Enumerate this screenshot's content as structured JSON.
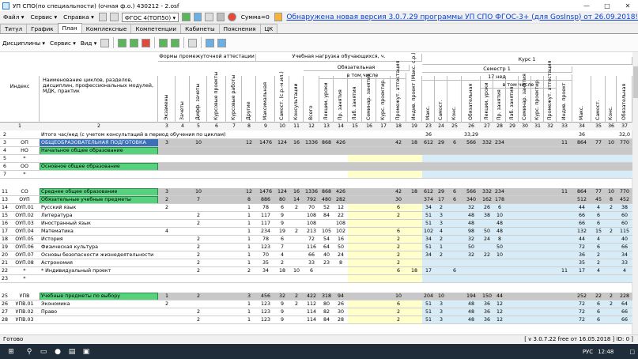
{
  "title": "УП СПО(по специальности) (очная ф.о.) 430212 - 2.osf",
  "menu": {
    "file": "Файл",
    "service": "Сервис",
    "help": "Справка",
    "fgos": "ФГОС 4(ТОП50)",
    "sum": "Сумма=0",
    "update": "Обнаружена новая версия 3.0.7.29 программы УП СПО ФГОС-3+ (для GosInsp) от 26.09.2018!"
  },
  "tabs": [
    "Титул",
    "График",
    "План",
    "Комплексные",
    "Компетенции",
    "Кабинеты",
    "Пояснения",
    "ЦК"
  ],
  "toolbar": {
    "disciplines": "Дисциплины",
    "service": "Сервис",
    "view": "Вид"
  },
  "header": {
    "index": "Индекс",
    "name": "Наименование циклов, разделов, дисциплин, профессиональных модулей, МДК, практик",
    "forms": "Формы промежуточной аттестации",
    "load": "Учебная нагрузка обучающихся, ч.",
    "obligatory": "Обязательная",
    "incl": "в том числе",
    "course1": "Курс 1",
    "sem1": "Семестр 1",
    "weeks": "17 нед",
    "incl2": "в том числе",
    "vert": {
      "c3": "Экзамены",
      "c4": "Зачеты",
      "c5": "Дифф. зачеты",
      "c6": "Курсовые проекты",
      "c7": "Курсовые работы",
      "c8": "Другие",
      "c9": "Максимальная",
      "c10": "Самост. (с.р.-н.ил.)",
      "c11": "Консультации",
      "c12": "Всего",
      "c13": "Лекции, уроки",
      "c14": "Пр. занятия",
      "c15": "Лаб. занятия",
      "c16": "Семинар. занятия",
      "c17": "Курс. проектир.",
      "c18": "Промежут. аттестация",
      "c19": "Индив. проект (Макс. с.р.)",
      "c23": "Макс.",
      "c24": "Самост.",
      "c25": "Конс.",
      "c26": "Обязательная",
      "c27": "Лекции, уроки",
      "c28": "Пр. занятия",
      "c29": "Лаб. занятия",
      "c30": "Семинар. занятия",
      "c31": "Курс. проектир.",
      "c32": "Промежут. аттестация",
      "c33": "Индив. проект",
      "c34": "Макс.",
      "c35": "Самост.",
      "c36": "Конс.",
      "c37": "Обязательная"
    }
  },
  "colnums": [
    "1",
    "2",
    "3",
    "4",
    "5",
    "6",
    "7",
    "8",
    "9",
    "10",
    "11",
    "12",
    "13",
    "14",
    "15",
    "16",
    "17",
    "18",
    "19",
    "20",
    "21",
    "22",
    "23",
    "24",
    "25",
    "26",
    "27",
    "28",
    "29",
    "30",
    "31",
    "32",
    "33",
    "34",
    "35",
    "36",
    "37"
  ],
  "rows": [
    {
      "n": "2",
      "idx": "",
      "name": "Итого час/нед (с учетом консультаций в период обучения по циклам)",
      "v": {
        "c23": "36",
        "c26": "33,29",
        "c34": "36",
        "c37": "32,0"
      }
    },
    {
      "n": "3",
      "idx": "ОП",
      "name": "ОБЩЕОБРАЗОВАТЕЛЬНАЯ ПОДГОТОВКА",
      "v": {
        "c3": "3",
        "c5": "10",
        "c8": "12",
        "c9": "1476",
        "c10": "124",
        "c11": "16",
        "c12": "1336",
        "c13": "868",
        "c14": "426",
        "c18": "42",
        "c19": "18",
        "c23": "612",
        "c24": "29",
        "c25": "6",
        "c26": "566",
        "c27": "332",
        "c28": "234",
        "c33": "11",
        "c34": "864",
        "c35": "77",
        "c36": "10",
        "c37": "770"
      }
    },
    {
      "n": "4",
      "idx": "НО",
      "name": "Начальное общее образование",
      "v": {}
    },
    {
      "n": "5",
      "idx": "*",
      "name": "",
      "v": {}
    },
    {
      "n": "6",
      "idx": "ОО",
      "name": "Основное общее образование",
      "v": {}
    },
    {
      "n": "7",
      "idx": "*",
      "name": "",
      "v": {}
    },
    {
      "n": "11",
      "idx": "СО",
      "name": "Среднее общее образование",
      "v": {
        "c3": "3",
        "c5": "10",
        "c8": "12",
        "c9": "1476",
        "c10": "124",
        "c11": "16",
        "c12": "1336",
        "c13": "868",
        "c14": "426",
        "c18": "42",
        "c19": "18",
        "c23": "612",
        "c24": "29",
        "c25": "6",
        "c26": "566",
        "c27": "332",
        "c28": "234",
        "c33": "11",
        "c34": "864",
        "c35": "77",
        "c36": "10",
        "c37": "770"
      }
    },
    {
      "n": "13",
      "idx": "ОУП",
      "name": "Обязательные учебные предметы",
      "v": {
        "c3": "2",
        "c5": "7",
        "c8": "8",
        "c9": "886",
        "c10": "80",
        "c11": "14",
        "c12": "792",
        "c13": "480",
        "c14": "282",
        "c18": "30",
        "c23": "374",
        "c24": "17",
        "c25": "6",
        "c26": "340",
        "c27": "162",
        "c28": "178",
        "c34": "512",
        "c35": "45",
        "c36": "8",
        "c37": "452"
      }
    },
    {
      "n": "14",
      "idx": "ОУП.01",
      "name": "Русский язык",
      "v": {
        "c3": "2",
        "c8": "1",
        "c9": "78",
        "c10": "6",
        "c11": "2",
        "c12": "70",
        "c13": "52",
        "c14": "12",
        "c18": "6",
        "c23": "34",
        "c24": "2",
        "c26": "32",
        "c27": "26",
        "c28": "6",
        "c34": "44",
        "c35": "4",
        "c36": "2",
        "c37": "38"
      }
    },
    {
      "n": "15",
      "idx": "ОУП.02",
      "name": "Литература",
      "v": {
        "c5": "2",
        "c8": "1",
        "c9": "117",
        "c10": "9",
        "c12": "108",
        "c13": "84",
        "c14": "22",
        "c18": "2",
        "c23": "51",
        "c24": "3",
        "c26": "48",
        "c27": "38",
        "c28": "10",
        "c34": "66",
        "c35": "6",
        "c37": "60"
      }
    },
    {
      "n": "16",
      "idx": "ОУП.03",
      "name": "Иностранный язык",
      "v": {
        "c5": "2",
        "c8": "1",
        "c9": "117",
        "c10": "9",
        "c12": "108",
        "c14": "108",
        "c23": "51",
        "c24": "3",
        "c26": "48",
        "c28": "48",
        "c34": "66",
        "c35": "6",
        "c37": "60"
      }
    },
    {
      "n": "17",
      "idx": "ОУП.04",
      "name": "Математика",
      "v": {
        "c3": "4",
        "c8": "1",
        "c9": "234",
        "c10": "19",
        "c11": "2",
        "c12": "213",
        "c13": "105",
        "c14": "102",
        "c18": "6",
        "c23": "102",
        "c24": "4",
        "c26": "98",
        "c27": "50",
        "c28": "48",
        "c34": "132",
        "c35": "15",
        "c36": "2",
        "c37": "115"
      }
    },
    {
      "n": "18",
      "idx": "ОУП.05",
      "name": "История",
      "v": {
        "c5": "2",
        "c8": "1",
        "c9": "78",
        "c10": "6",
        "c12": "72",
        "c13": "54",
        "c14": "16",
        "c18": "2",
        "c23": "34",
        "c24": "2",
        "c26": "32",
        "c27": "24",
        "c28": "8",
        "c34": "44",
        "c35": "4",
        "c37": "40"
      }
    },
    {
      "n": "19",
      "idx": "ОУП.06",
      "name": "Физическая культура",
      "v": {
        "c5": "2",
        "c8": "1",
        "c9": "123",
        "c10": "7",
        "c12": "116",
        "c13": "64",
        "c14": "50",
        "c18": "2",
        "c23": "51",
        "c24": "1",
        "c26": "50",
        "c28": "50",
        "c34": "72",
        "c35": "6",
        "c37": "66"
      }
    },
    {
      "n": "20",
      "idx": "ОУП.07",
      "name": "Основы безопасности жизнедеятельности",
      "v": {
        "c5": "2",
        "c8": "1",
        "c9": "70",
        "c10": "4",
        "c12": "66",
        "c13": "40",
        "c14": "24",
        "c18": "2",
        "c23": "34",
        "c24": "2",
        "c26": "32",
        "c27": "22",
        "c28": "10",
        "c34": "36",
        "c35": "2",
        "c37": "34"
      }
    },
    {
      "n": "21",
      "idx": "ОУП.08",
      "name": "Астрономия",
      "v": {
        "c5": "2",
        "c8": "1",
        "c9": "35",
        "c10": "2",
        "c12": "33",
        "c13": "23",
        "c14": "8",
        "c18": "2",
        "c34": "35",
        "c35": "2",
        "c37": "33"
      }
    },
    {
      "n": "22",
      "idx": "*",
      "name": "* Индивидуальный проект",
      "v": {
        "c5": "2",
        "c8": "2",
        "c9": "34",
        "c10": "18",
        "c11": "10",
        "c12": "6",
        "c18": "6",
        "c19": "18",
        "c23": "17",
        "c25": "6",
        "c33": "11",
        "c34": "17",
        "c35": "4",
        "c37": "4"
      }
    },
    {
      "n": "23",
      "idx": "*",
      "name": "",
      "v": {}
    },
    {
      "n": "25",
      "idx": "УПВ",
      "name": "Учебные предметы по выбору",
      "v": {
        "c3": "1",
        "c5": "2",
        "c8": "3",
        "c9": "456",
        "c10": "32",
        "c11": "2",
        "c12": "422",
        "c13": "318",
        "c14": "94",
        "c18": "10",
        "c23": "204",
        "c24": "10",
        "c26": "194",
        "c27": "150",
        "c28": "44",
        "c34": "252",
        "c35": "22",
        "c36": "2",
        "c37": "228"
      }
    },
    {
      "n": "26",
      "idx": "УПВ.01",
      "name": "Экономика",
      "v": {
        "c3": "2",
        "c8": "1",
        "c9": "123",
        "c10": "9",
        "c11": "2",
        "c12": "112",
        "c13": "80",
        "c14": "26",
        "c18": "6",
        "c23": "51",
        "c24": "3",
        "c26": "48",
        "c27": "36",
        "c28": "12",
        "c34": "72",
        "c35": "6",
        "c36": "2",
        "c37": "64"
      }
    },
    {
      "n": "27",
      "idx": "УПВ.02",
      "name": "Право",
      "v": {
        "c5": "2",
        "c8": "1",
        "c9": "123",
        "c10": "9",
        "c12": "114",
        "c13": "82",
        "c14": "30",
        "c18": "2",
        "c23": "51",
        "c24": "3",
        "c26": "48",
        "c27": "36",
        "c28": "12",
        "c34": "72",
        "c35": "6",
        "c37": "66"
      }
    },
    {
      "n": "28",
      "idx": "УПВ.03",
      "name": "",
      "v": {
        "c5": "2",
        "c8": "1",
        "c9": "123",
        "c10": "9",
        "c12": "114",
        "c13": "84",
        "c14": "28",
        "c18": "2",
        "c23": "51",
        "c24": "3",
        "c26": "48",
        "c27": "36",
        "c28": "12",
        "c34": "72",
        "c35": "6",
        "c37": "66"
      }
    }
  ],
  "status": {
    "left": "Готово",
    "right": "[ v 3.0.7.22 free от 16.05.2018 ] ID: 0 ]"
  },
  "tray": {
    "lang": "РУС",
    "time": "12:48"
  },
  "colors": {
    "green": "#56d17c",
    "yellow": "#ffffcc",
    "blue": "#d7ecf7",
    "sel": "#3b6fb6"
  }
}
